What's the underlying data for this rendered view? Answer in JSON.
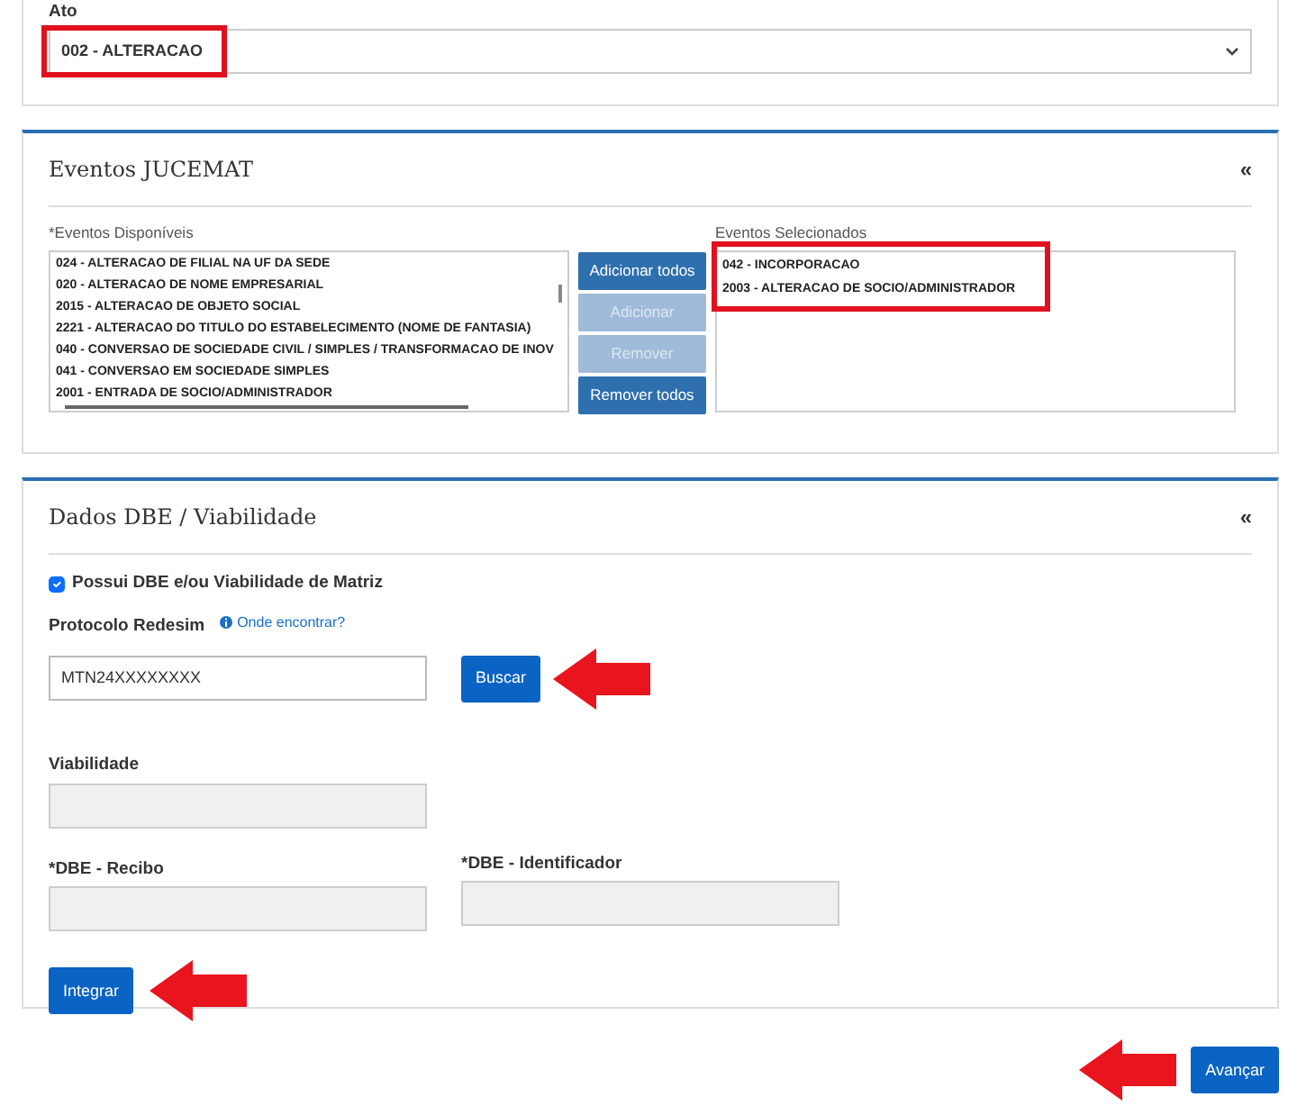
{
  "ato": {
    "label": "Ato",
    "value": "002 - ALTERACAO"
  },
  "eventos": {
    "title": "Eventos JUCEMAT",
    "collapse": "«",
    "available_label": "*Eventos Disponíveis",
    "selected_label": "Eventos Selecionados",
    "available": [
      "024 - ALTERACAO DE FILIAL NA UF DA SEDE",
      "020 - ALTERACAO DE NOME EMPRESARIAL",
      "2015 - ALTERACAO DE OBJETO SOCIAL",
      "2221 - ALTERACAO DO TITULO DO ESTABELECIMENTO (NOME DE FANTASIA)",
      "040 - CONVERSAO DE SOCIEDADE CIVIL / SIMPLES / TRANSFORMACAO DE INOV",
      "041 - CONVERSAO EM SOCIEDADE SIMPLES",
      "2001 - ENTRADA DE SOCIO/ADMINISTRADOR"
    ],
    "buttons": [
      {
        "label": "Adicionar todos",
        "disabled": false
      },
      {
        "label": "Adicionar",
        "disabled": true
      },
      {
        "label": "Remover",
        "disabled": true
      },
      {
        "label": "Remover todos",
        "disabled": false
      }
    ],
    "selected": [
      "042 - INCORPORACAO",
      "2003 - ALTERACAO DE SOCIO/ADMINISTRADOR"
    ]
  },
  "dbe": {
    "title": "Dados DBE / Viabilidade",
    "collapse": "«",
    "checkbox": {
      "label": "Possui DBE e/ou Viabilidade de Matriz",
      "checked": true
    },
    "protocolo": {
      "label": "Protocolo Redesim",
      "help": "Onde encontrar?",
      "value": "MTN24XXXXXXXX"
    },
    "search_button": "Buscar",
    "viabilidade": {
      "label": "Viabilidade"
    },
    "recibo": {
      "label": "*DBE - Recibo"
    },
    "identificador": {
      "label": "*DBE - Identificador"
    },
    "integrate_button": "Integrar"
  },
  "next_button": "Avançar"
}
